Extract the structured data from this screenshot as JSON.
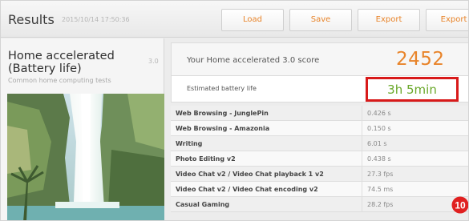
{
  "header": {
    "title": "Results",
    "timestamp": "2015/10/14 17:50:36",
    "buttons": {
      "load": "Load",
      "save": "Save",
      "export": "Export",
      "export2": "Export"
    }
  },
  "test": {
    "title": "Home accelerated (Battery life)",
    "version": "3.0",
    "subtitle": "Common home computing tests"
  },
  "score": {
    "label": "Your Home accelerated 3.0 score",
    "value": "2452"
  },
  "battery": {
    "label": "Estimated battery life",
    "value": "3h 5min"
  },
  "results": [
    {
      "name": "Web Browsing - JunglePin",
      "value": "0.426 s"
    },
    {
      "name": "Web Browsing - Amazonia",
      "value": "0.150 s"
    },
    {
      "name": "Writing",
      "value": "6.01 s"
    },
    {
      "name": "Photo Editing v2",
      "value": "0.438 s"
    },
    {
      "name": "Video Chat v2 / Video Chat playback 1 v2",
      "value": "27.3 fps"
    },
    {
      "name": "Video Chat v2 / Video Chat encoding v2",
      "value": "74.5 ms"
    },
    {
      "name": "Casual Gaming",
      "value": "28.2 fps"
    }
  ],
  "badge": {
    "number": "10"
  },
  "colors": {
    "accent": "#e8842a",
    "highlight_border": "#d81a1a",
    "battery_text": "#6aa82a"
  }
}
